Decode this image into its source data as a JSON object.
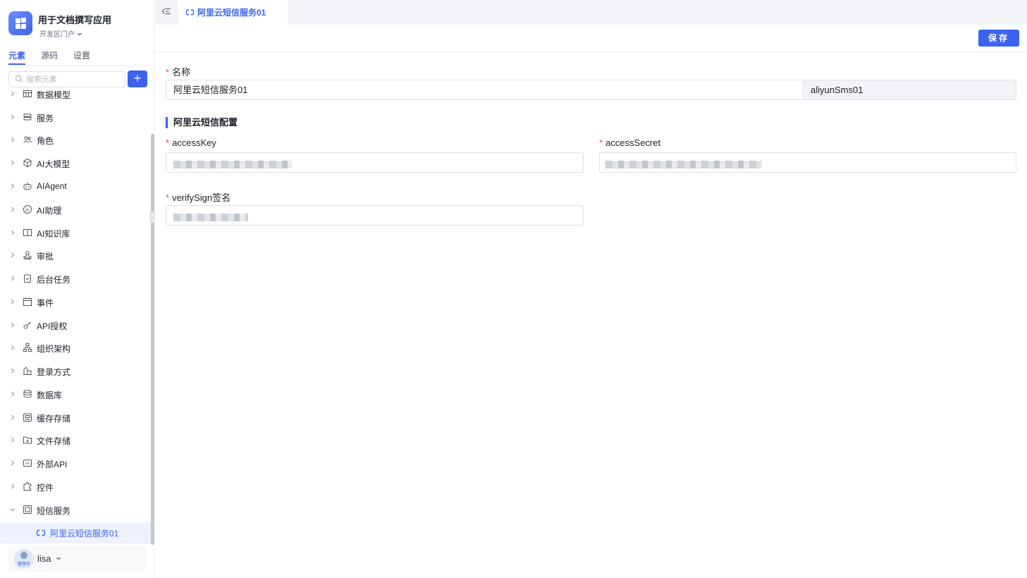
{
  "app": {
    "title": "用于文档撰写应用",
    "portal": "开发区门户"
  },
  "sidebar": {
    "tabs": [
      {
        "label": "元素",
        "active": true
      },
      {
        "label": "源码",
        "active": false
      },
      {
        "label": "设置",
        "active": false
      }
    ],
    "search_placeholder": "搜索元素",
    "add_label": "+",
    "items": [
      {
        "label": "数据模型",
        "icon": "table-icon"
      },
      {
        "label": "服务",
        "icon": "server-icon"
      },
      {
        "label": "角色",
        "icon": "users-icon"
      },
      {
        "label": "AI大模型",
        "icon": "cube-icon"
      },
      {
        "label": "AIAgent",
        "icon": "robot-icon"
      },
      {
        "label": "AI助理",
        "icon": "ai-assistant-icon"
      },
      {
        "label": "AI知识库",
        "icon": "book-icon"
      },
      {
        "label": "审批",
        "icon": "stamp-icon"
      },
      {
        "label": "后台任务",
        "icon": "task-icon"
      },
      {
        "label": "事件",
        "icon": "calendar-icon"
      },
      {
        "label": "API授权",
        "icon": "key-icon"
      },
      {
        "label": "组织架构",
        "icon": "org-icon"
      },
      {
        "label": "登录方式",
        "icon": "login-icon"
      },
      {
        "label": "数据库",
        "icon": "database-icon"
      },
      {
        "label": "缓存存储",
        "icon": "cache-icon"
      },
      {
        "label": "文件存储",
        "icon": "file-storage-icon"
      },
      {
        "label": "外部API",
        "icon": "api-icon"
      },
      {
        "label": "控件",
        "icon": "puzzle-icon"
      },
      {
        "label": "短信服务",
        "icon": "sms-icon",
        "expanded": true
      }
    ],
    "active_child": {
      "label": "阿里云短信服务01",
      "icon": "link-icon"
    },
    "user": {
      "name": "lisa",
      "role": "管理员"
    }
  },
  "topbar": {
    "tab_label": "阿里云短信服务01"
  },
  "toolbar": {
    "save_label": "保存"
  },
  "form": {
    "name_label": "名称",
    "name_value": "阿里云短信服务01",
    "code_value": "aliyunSms01",
    "section_title": "阿里云短信配置",
    "access_key_label": "accessKey",
    "access_secret_label": "accessSecret",
    "verify_sign_label": "verifySign签名"
  },
  "colors": {
    "accent": "#3b63f0",
    "required": "#e5484d"
  }
}
